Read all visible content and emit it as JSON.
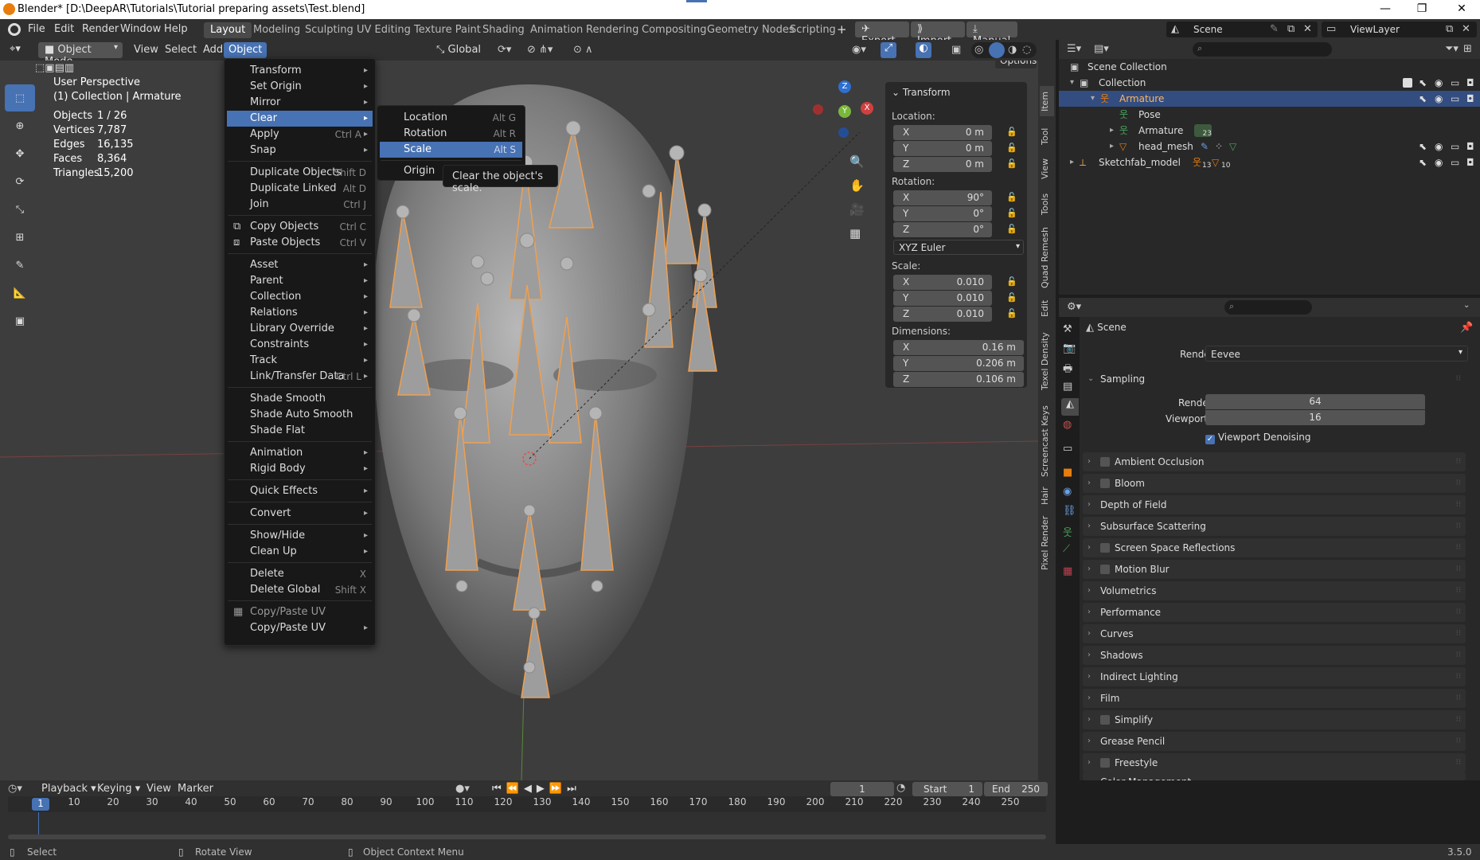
{
  "window": {
    "title": "Blender* [D:\\DeepAR\\Tutorials\\Tutorial preparing assets\\Test.blend]",
    "minimize": "—",
    "maximize": "❐",
    "close": "✕"
  },
  "topbar": {
    "menus": [
      "File",
      "Edit",
      "Render",
      "Window",
      "Help"
    ],
    "workspaces": [
      "Layout",
      "Modeling",
      "Sculpting",
      "UV Editing",
      "Texture Paint",
      "Shading",
      "Animation",
      "Rendering",
      "Compositing",
      "Geometry Nodes",
      "Scripting"
    ],
    "active_workspace": "Layout",
    "add_tab": "+",
    "addons": [
      "Export",
      "Import",
      "Manual"
    ],
    "scene": "Scene",
    "view_layer": "ViewLayer"
  },
  "viewport_header": {
    "mode": "Object Mode",
    "menus": [
      "View",
      "Select",
      "Add",
      "Object"
    ],
    "active_menu": "Object",
    "orientation": "Global",
    "options": "Options"
  },
  "viewport_info": {
    "perspective": "User Perspective",
    "collection": "(1) Collection | Armature",
    "stats": [
      {
        "label": "Objects",
        "value": "1 / 26"
      },
      {
        "label": "Vertices",
        "value": "7,787"
      },
      {
        "label": "Edges",
        "value": "16,135"
      },
      {
        "label": "Faces",
        "value": "8,364"
      },
      {
        "label": "Triangles",
        "value": "15,200"
      }
    ]
  },
  "gizmo": {
    "z": "Z",
    "y": "Y",
    "x": "X"
  },
  "object_menu": {
    "groups": [
      [
        {
          "label": "Transform",
          "submenu": true
        },
        {
          "label": "Set Origin",
          "submenu": true
        },
        {
          "label": "Mirror",
          "submenu": true
        },
        {
          "label": "Clear",
          "submenu": true,
          "highlighted": true
        },
        {
          "label": "Apply",
          "shortcut": "Ctrl A",
          "submenu": true
        },
        {
          "label": "Snap",
          "submenu": true
        }
      ],
      [
        {
          "label": "Duplicate Objects",
          "shortcut": "Shift D"
        },
        {
          "label": "Duplicate Linked",
          "shortcut": "Alt D"
        },
        {
          "label": "Join",
          "shortcut": "Ctrl J"
        }
      ],
      [
        {
          "label": "Copy Objects",
          "shortcut": "Ctrl C",
          "icon": "copy-icon"
        },
        {
          "label": "Paste Objects",
          "shortcut": "Ctrl V",
          "icon": "paste-icon"
        }
      ],
      [
        {
          "label": "Asset",
          "submenu": true
        },
        {
          "label": "Parent",
          "submenu": true
        },
        {
          "label": "Collection",
          "submenu": true
        },
        {
          "label": "Relations",
          "submenu": true
        },
        {
          "label": "Library Override",
          "submenu": true
        },
        {
          "label": "Constraints",
          "submenu": true
        },
        {
          "label": "Track",
          "submenu": true
        },
        {
          "label": "Link/Transfer Data",
          "shortcut": "Ctrl L",
          "submenu": true
        }
      ],
      [
        {
          "label": "Shade Smooth"
        },
        {
          "label": "Shade Auto Smooth"
        },
        {
          "label": "Shade Flat"
        }
      ],
      [
        {
          "label": "Animation",
          "submenu": true
        },
        {
          "label": "Rigid Body",
          "submenu": true
        }
      ],
      [
        {
          "label": "Quick Effects",
          "submenu": true
        }
      ],
      [
        {
          "label": "Convert",
          "submenu": true
        }
      ],
      [
        {
          "label": "Show/Hide",
          "submenu": true
        },
        {
          "label": "Clean Up",
          "submenu": true
        }
      ],
      [
        {
          "label": "Delete",
          "shortcut": "X"
        },
        {
          "label": "Delete Global",
          "shortcut": "Shift X"
        }
      ],
      [
        {
          "label": "Copy/Paste UV",
          "disabled": true,
          "icon": "uv-icon"
        },
        {
          "label": "Copy/Paste UV",
          "submenu": true
        }
      ]
    ]
  },
  "clear_submenu": [
    {
      "label": "Location",
      "shortcut": "Alt G"
    },
    {
      "label": "Rotation",
      "shortcut": "Alt R"
    },
    {
      "label": "Scale",
      "shortcut": "Alt S",
      "highlighted": true
    },
    {
      "label": "Origin"
    }
  ],
  "tooltip": "Clear the object's scale.",
  "transform_panel": {
    "title": "Transform",
    "location_label": "Location:",
    "location": [
      {
        "axis": "X",
        "value": "0 m"
      },
      {
        "axis": "Y",
        "value": "0 m"
      },
      {
        "axis": "Z",
        "value": "0 m"
      }
    ],
    "rotation_label": "Rotation:",
    "rotation": [
      {
        "axis": "X",
        "value": "90°"
      },
      {
        "axis": "Y",
        "value": "0°"
      },
      {
        "axis": "Z",
        "value": "0°"
      }
    ],
    "rotation_mode": "XYZ Euler",
    "scale_label": "Scale:",
    "scale": [
      {
        "axis": "X",
        "value": "0.010"
      },
      {
        "axis": "Y",
        "value": "0.010"
      },
      {
        "axis": "Z",
        "value": "0.010"
      }
    ],
    "dimensions_label": "Dimensions:",
    "dimensions": [
      {
        "axis": "X",
        "value": "0.16 m"
      },
      {
        "axis": "Y",
        "value": "0.206 m"
      },
      {
        "axis": "Z",
        "value": "0.106 m"
      }
    ]
  },
  "sidebar_tabs": [
    "Item",
    "Tool",
    "View",
    "Tools",
    "Quad Remesh",
    "Edit",
    "Texel Density",
    "Screencast Keys",
    "Hair",
    "Pixel Render"
  ],
  "outliner": {
    "rows": [
      {
        "label": "Scene Collection",
        "indent": 0
      },
      {
        "label": "Collection",
        "indent": 1
      },
      {
        "label": "Armature",
        "indent": 2,
        "selected": true
      },
      {
        "label": "Pose",
        "indent": 3
      },
      {
        "label": "Armature",
        "indent": 3,
        "badge": "23"
      },
      {
        "label": "head_mesh",
        "indent": 3
      },
      {
        "label": "Sketchfab_model",
        "indent": 1,
        "badge1": "13",
        "badge2": "10"
      }
    ]
  },
  "properties": {
    "context": "Scene",
    "render_engine_label": "Render Engine",
    "render_engine": "Eevee",
    "sampling": {
      "title": "Sampling",
      "render_label": "Render",
      "render": "64",
      "viewport_label": "Viewport",
      "viewport": "16",
      "denoise": "Viewport Denoising"
    },
    "sections": [
      {
        "label": "Ambient Occlusion",
        "checkbox": true
      },
      {
        "label": "Bloom",
        "checkbox": true
      },
      {
        "label": "Depth of Field"
      },
      {
        "label": "Subsurface Scattering"
      },
      {
        "label": "Screen Space Reflections",
        "checkbox": true
      },
      {
        "label": "Motion Blur",
        "checkbox": true
      },
      {
        "label": "Volumetrics"
      },
      {
        "label": "Performance"
      },
      {
        "label": "Curves"
      },
      {
        "label": "Shadows"
      },
      {
        "label": "Indirect Lighting"
      },
      {
        "label": "Film"
      },
      {
        "label": "Simplify",
        "checkbox": true
      },
      {
        "label": "Grease Pencil"
      },
      {
        "label": "Freestyle",
        "checkbox": true
      },
      {
        "label": "Color Management"
      }
    ]
  },
  "timeline": {
    "menus": [
      "Playback",
      "Keying",
      "View",
      "Marker"
    ],
    "current_frame": "1",
    "start_label": "Start",
    "start": "1",
    "end_label": "End",
    "end": "250",
    "ticks": [
      "1",
      "10",
      "20",
      "30",
      "40",
      "50",
      "60",
      "70",
      "80",
      "90",
      "100",
      "110",
      "120",
      "130",
      "140",
      "150",
      "160",
      "170",
      "180",
      "190",
      "200",
      "210",
      "220",
      "230",
      "240",
      "250"
    ]
  },
  "statusbar": {
    "select": "Select",
    "rotate": "Rotate View",
    "context": "Object Context Menu",
    "version": "3.5.0"
  },
  "colors": {
    "accent": "#4772b3",
    "orange": "#e87d0d",
    "bone": "#f0a050"
  }
}
